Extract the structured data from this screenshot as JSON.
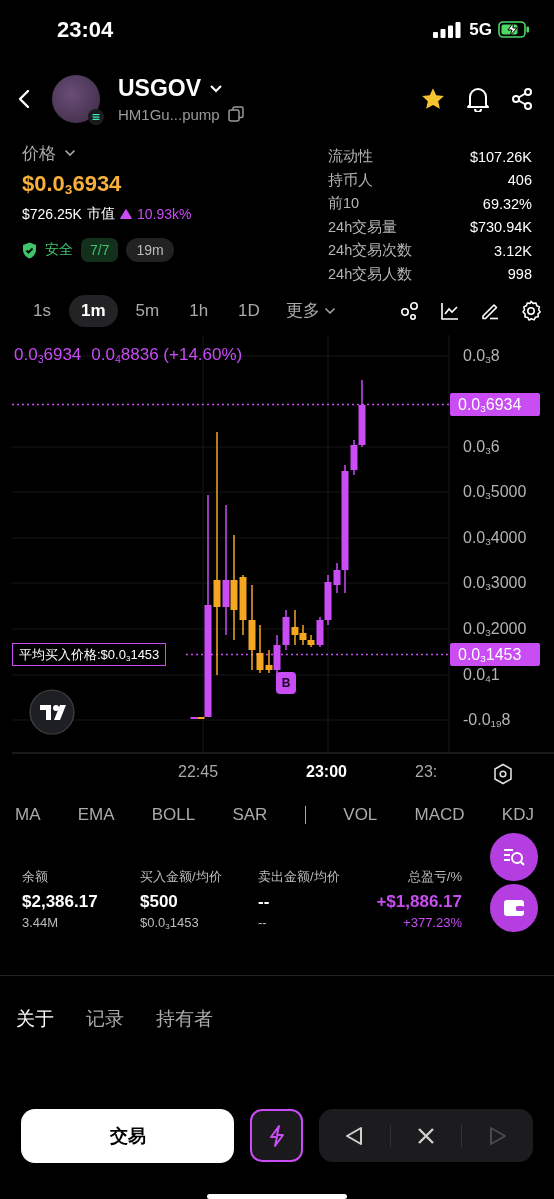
{
  "status_bar": {
    "time": "23:04",
    "network": "5G"
  },
  "token": {
    "name": "USGOV",
    "address": "HM1Gu...pump",
    "favorite": true
  },
  "price": {
    "label": "价格",
    "value": "$0.0$_{3}$6934",
    "market_cap": "$726.25K",
    "market_cap_label": "市值",
    "change": "10.93k%",
    "safety_label": "安全",
    "safety_score": "7/7",
    "age": "19m"
  },
  "stats": [
    {
      "label": "流动性",
      "value": "$107.26K"
    },
    {
      "label": "持币人",
      "value": "406"
    },
    {
      "label": "前10",
      "value": "69.32%"
    },
    {
      "label": "24h交易量",
      "value": "$730.94K"
    },
    {
      "label": "24h交易次数",
      "value": "3.12K"
    },
    {
      "label": "24h交易人数",
      "value": "998"
    }
  ],
  "timeframes": [
    {
      "label": "1s",
      "selected": false
    },
    {
      "label": "1m",
      "selected": true
    },
    {
      "label": "5m",
      "selected": false
    },
    {
      "label": "1h",
      "selected": false
    },
    {
      "label": "1D",
      "selected": false
    }
  ],
  "more_label": "更多",
  "chart": {
    "last_price": "0.0$_{3}$6934",
    "change": "0.0$_{4}$8836 (+14.60%)",
    "y_ticks": [
      "0.0$_{3}$8",
      "0.0$_{3}$6",
      "0.0$_{3}$5000",
      "0.0$_{3}$4000",
      "0.0$_{3}$3000",
      "0.0$_{3}$2000",
      "0.0$_{4}$1",
      "-0.0$_{19}$8"
    ],
    "current_tag": "0.0$_{3}$6934",
    "avg_tag": "0.0$_{3}$1453",
    "avg_label": "平均买入价格:$0.0$_{3}$1453",
    "marker": "B",
    "time_labels": [
      {
        "label": "22:45",
        "bold": false
      },
      {
        "label": "23:00",
        "bold": true
      },
      {
        "label": "23:",
        "bold": false
      }
    ]
  },
  "main_indicators": [
    "MA",
    "EMA",
    "BOLL",
    "SAR"
  ],
  "sub_indicators": [
    "VOL",
    "MACD",
    "KDJ"
  ],
  "position": [
    {
      "label": "余额",
      "value": "$2,386.17",
      "sub": "3.44M",
      "kind": "plain"
    },
    {
      "label": "买入金额/均价",
      "value": "$500",
      "sub": "$0.0$_{3}$1453",
      "kind": "plain"
    },
    {
      "label": "卖出金额/均价",
      "value": "--",
      "sub": "--",
      "kind": "plain"
    },
    {
      "label": "总盈亏/%",
      "value": "+$1,886.17",
      "sub": "+377.23%",
      "kind": "profit"
    }
  ],
  "tabs": [
    {
      "label": "关于",
      "selected": true
    },
    {
      "label": "记录",
      "selected": false
    },
    {
      "label": "持有者",
      "selected": false
    }
  ],
  "actions": {
    "trade": "交易",
    "nav": [
      {
        "kind": "prev",
        "disabled": false
      },
      {
        "kind": "close",
        "disabled": false
      },
      {
        "kind": "next",
        "disabled": true
      }
    ]
  }
}
